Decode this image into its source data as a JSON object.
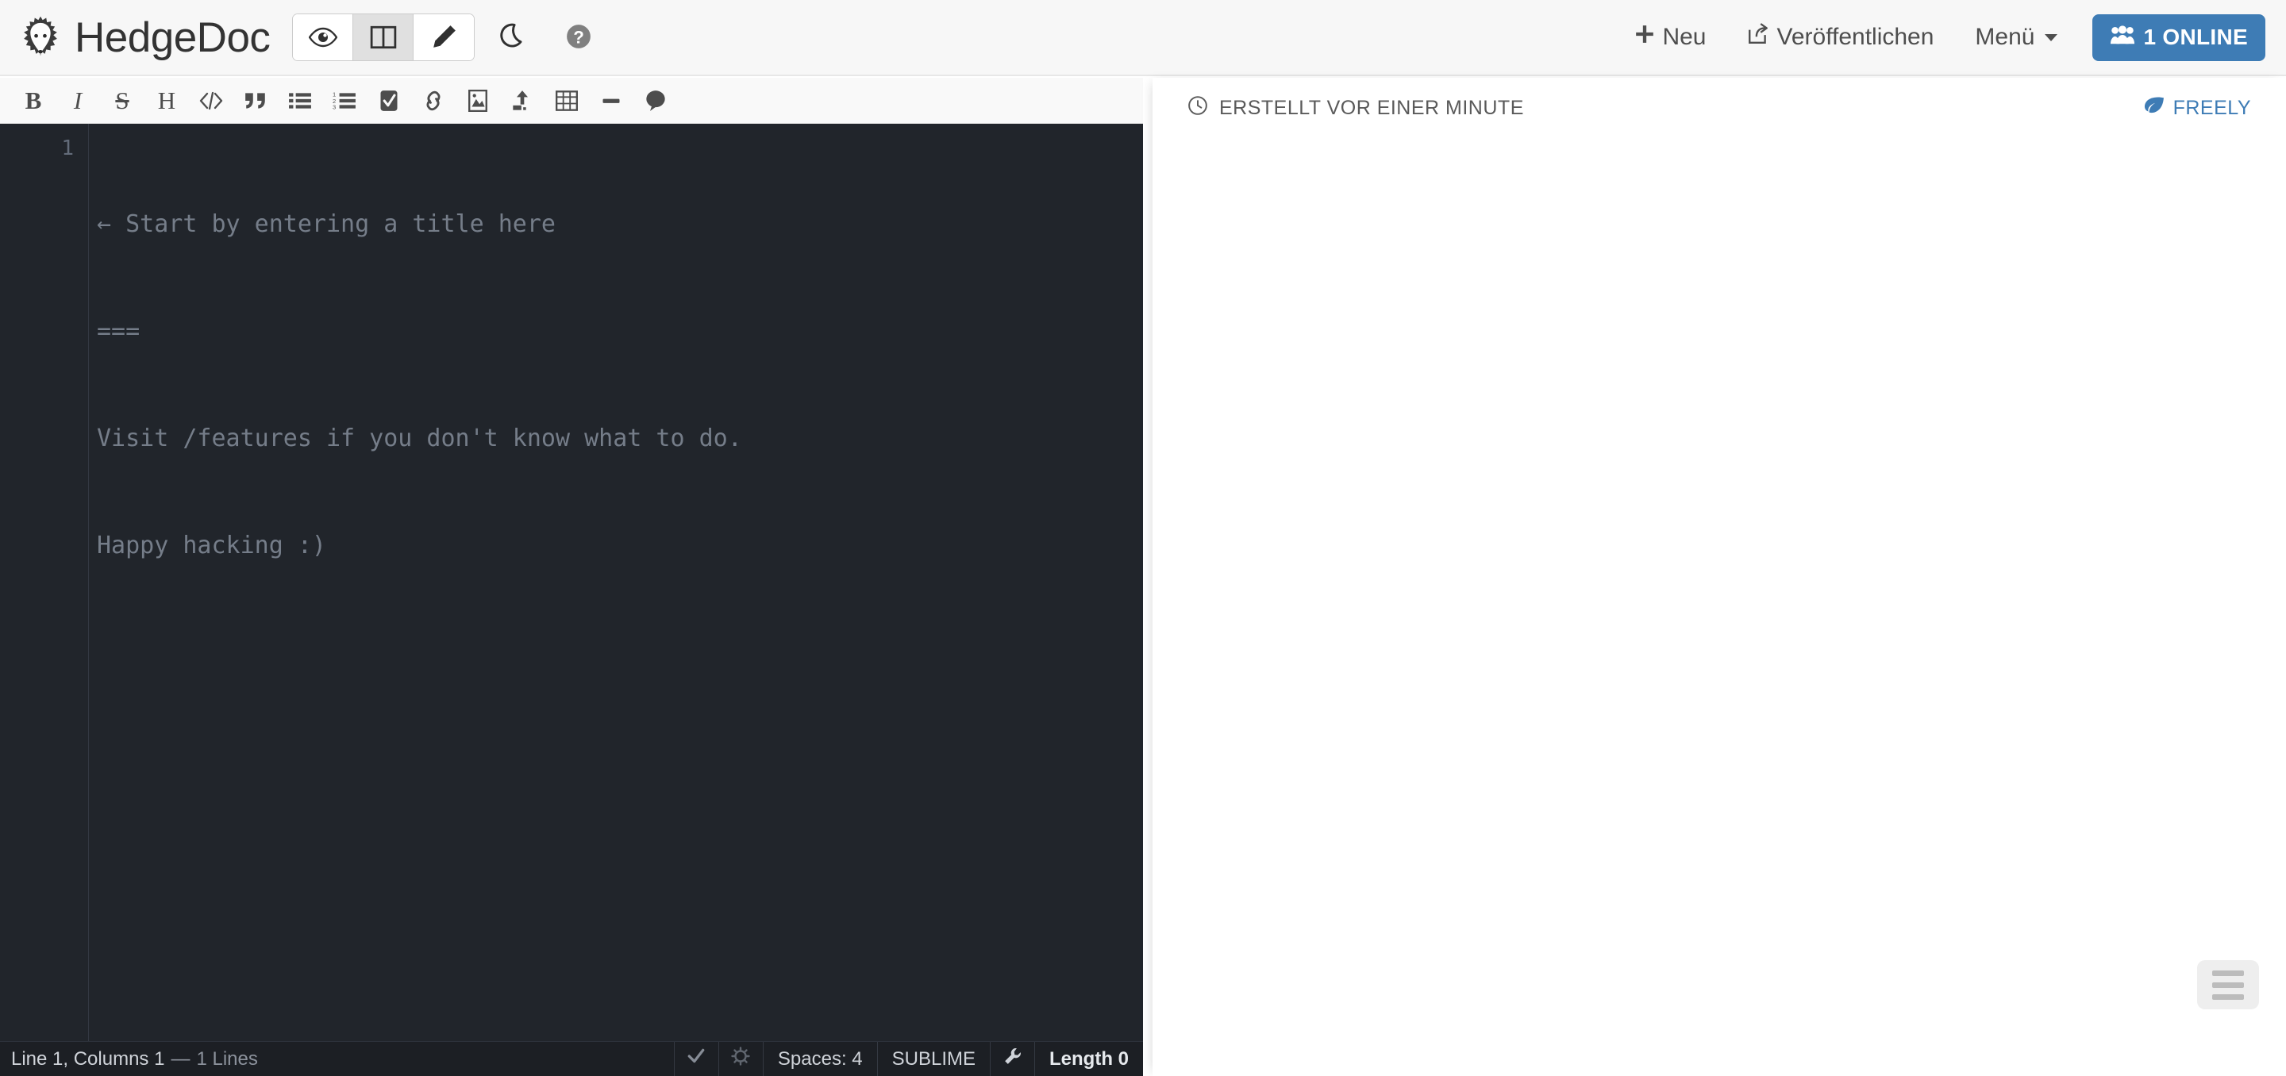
{
  "app": {
    "brand": "HedgeDoc",
    "logo_icon": "hedgehog-logo"
  },
  "navbar": {
    "view_modes": [
      {
        "name": "view-mode-preview",
        "icon": "eye-icon",
        "active": false
      },
      {
        "name": "view-mode-both",
        "icon": "columns-icon",
        "active": true
      },
      {
        "name": "view-mode-edit",
        "icon": "pencil-icon",
        "active": false
      }
    ],
    "night_mode": {
      "label": "",
      "icon": "moon-icon"
    },
    "help": {
      "label": "",
      "icon": "question-circle-icon"
    },
    "new_label": "Neu",
    "new_icon": "plus-icon",
    "publish_label": "Veröffentlichen",
    "publish_icon": "share-square-icon",
    "menu_label": "Menü",
    "menu_caret_icon": "caret-down-icon",
    "online_label": "1 ONLINE",
    "online_icon": "users-icon",
    "online_color": "#3e7cb5"
  },
  "toolbar": {
    "buttons": [
      {
        "name": "bold-button",
        "icon": "bold-icon",
        "glyph": "B",
        "title": "Bold"
      },
      {
        "name": "italic-button",
        "icon": "italic-icon",
        "glyph": "I",
        "title": "Italic"
      },
      {
        "name": "strikethrough-button",
        "icon": "strikethrough-icon",
        "glyph": "S",
        "title": "Strikethrough"
      },
      {
        "name": "heading-button",
        "icon": "heading-icon",
        "glyph": "H",
        "title": "Heading"
      },
      {
        "name": "code-button",
        "icon": "code-icon",
        "glyph": "</>",
        "title": "Code"
      },
      {
        "name": "quote-button",
        "icon": "quote-icon",
        "glyph": "”",
        "title": "Quote"
      },
      {
        "name": "unordered-list-button",
        "icon": "list-ul-icon",
        "glyph": "",
        "title": "Unordered List"
      },
      {
        "name": "ordered-list-button",
        "icon": "list-ol-icon",
        "glyph": "",
        "title": "Ordered List"
      },
      {
        "name": "check-list-button",
        "icon": "check-square-icon",
        "glyph": "",
        "title": "Check List"
      },
      {
        "name": "link-button",
        "icon": "link-icon",
        "glyph": "",
        "title": "Link"
      },
      {
        "name": "image-button",
        "icon": "image-icon",
        "glyph": "",
        "title": "Image"
      },
      {
        "name": "upload-button",
        "icon": "upload-icon",
        "glyph": "",
        "title": "Upload Image"
      },
      {
        "name": "table-button",
        "icon": "table-icon",
        "glyph": "",
        "title": "Table"
      },
      {
        "name": "horizontal-rule-button",
        "icon": "minus-icon",
        "glyph": "",
        "title": "Horizontal Rule"
      },
      {
        "name": "comment-button",
        "icon": "comment-icon",
        "glyph": "",
        "title": "Comment"
      }
    ]
  },
  "editor": {
    "line_number": "1",
    "placeholder_lines": [
      "← Start by entering a title here",
      "===",
      "Visit /features if you don't know what to do.",
      "Happy hacking :)"
    ],
    "background": "#21252b"
  },
  "statusbar": {
    "cursor_text": "Line 1, Columns 1",
    "separator": "—",
    "lines_text": "1 Lines",
    "saved_icon": "check-icon",
    "sync_icon": "spinner-icon",
    "indent_label": "Spaces: 4",
    "keymap_label": "SUBLIME",
    "settings_icon": "wrench-icon",
    "length_label": "Length 0"
  },
  "preview": {
    "created_icon": "clock-icon",
    "created_text": "ERSTELLT VOR EINER MINUTE",
    "permission_icon": "leaf-icon",
    "permission_text": "FREELY",
    "permission_color": "#3e7cb5",
    "toc_button_icon": "bars-icon"
  }
}
